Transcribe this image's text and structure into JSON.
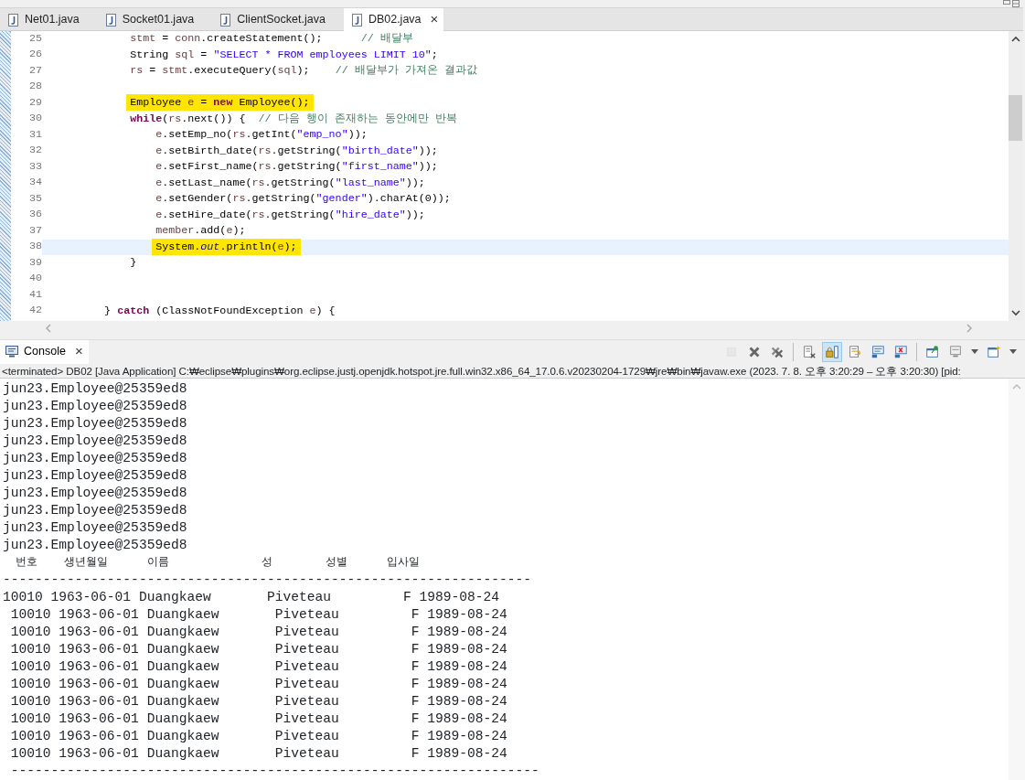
{
  "editor_tabs": [
    {
      "label": "Net01.java",
      "selected": false,
      "closable": false
    },
    {
      "label": "Socket01.java",
      "selected": false,
      "closable": false
    },
    {
      "label": "ClientSocket.java",
      "selected": false,
      "closable": false
    },
    {
      "label": "DB02.java",
      "selected": true,
      "closable": true,
      "close": "×"
    }
  ],
  "editor": {
    "lines": [
      {
        "number": "25",
        "marked": false,
        "current": false,
        "tokens": [
          {
            "text": "            stmt",
            "kind": "var"
          },
          {
            "text": " = ",
            "kind": "plain"
          },
          {
            "text": "conn",
            "kind": "var"
          },
          {
            "text": ".createStatement();      ",
            "kind": "plain"
          },
          {
            "text": "// 배달부",
            "kind": "comment"
          }
        ]
      },
      {
        "number": "26",
        "marked": false,
        "current": false,
        "tokens": [
          {
            "text": "            String ",
            "kind": "plain"
          },
          {
            "text": "sql",
            "kind": "var"
          },
          {
            "text": " = ",
            "kind": "plain"
          },
          {
            "text": "\"SELECT * FROM employees LIMIT 10\"",
            "kind": "string"
          },
          {
            "text": ";",
            "kind": "plain"
          }
        ]
      },
      {
        "number": "27",
        "marked": false,
        "current": false,
        "tokens": [
          {
            "text": "            rs",
            "kind": "var"
          },
          {
            "text": " = ",
            "kind": "plain"
          },
          {
            "text": "stmt",
            "kind": "var"
          },
          {
            "text": ".executeQuery(",
            "kind": "plain"
          },
          {
            "text": "sql",
            "kind": "var"
          },
          {
            "text": ");    ",
            "kind": "plain"
          },
          {
            "text": "// 배달부가 가져온 결과값",
            "kind": "comment"
          }
        ]
      },
      {
        "number": "28"
      },
      {
        "number": "29",
        "marked": true,
        "current": false,
        "tokens": [
          {
            "text": "            Employee ",
            "kind": "plain"
          },
          {
            "text": "e",
            "kind": "var"
          },
          {
            "text": " = ",
            "kind": "plain"
          },
          {
            "text": "new",
            "kind": "keyword"
          },
          {
            "text": " Employee();",
            "kind": "plain"
          }
        ]
      },
      {
        "number": "30",
        "marked": false,
        "current": false,
        "tokens": [
          {
            "text": "            while",
            "kind": "keyword"
          },
          {
            "text": "(",
            "kind": "plain"
          },
          {
            "text": "rs",
            "kind": "var"
          },
          {
            "text": ".next()) {  ",
            "kind": "plain"
          },
          {
            "text": "// 다음 행이 존재하는 동안에만 반복",
            "kind": "comment"
          }
        ]
      },
      {
        "number": "31",
        "marked": false,
        "current": false,
        "tokens": [
          {
            "text": "                e",
            "kind": "var"
          },
          {
            "text": ".setEmp_no(",
            "kind": "plain"
          },
          {
            "text": "rs",
            "kind": "var"
          },
          {
            "text": ".getInt(",
            "kind": "plain"
          },
          {
            "text": "\"emp_no\"",
            "kind": "string"
          },
          {
            "text": "));",
            "kind": "plain"
          }
        ]
      },
      {
        "number": "32",
        "marked": false,
        "current": false,
        "tokens": [
          {
            "text": "                e",
            "kind": "var"
          },
          {
            "text": ".setBirth_date(",
            "kind": "plain"
          },
          {
            "text": "rs",
            "kind": "var"
          },
          {
            "text": ".getString(",
            "kind": "plain"
          },
          {
            "text": "\"birth_date\"",
            "kind": "string"
          },
          {
            "text": "));",
            "kind": "plain"
          }
        ]
      },
      {
        "number": "33",
        "marked": false,
        "current": false,
        "tokens": [
          {
            "text": "                e",
            "kind": "var"
          },
          {
            "text": ".setFirst_name(",
            "kind": "plain"
          },
          {
            "text": "rs",
            "kind": "var"
          },
          {
            "text": ".getString(",
            "kind": "plain"
          },
          {
            "text": "\"first_name\"",
            "kind": "string"
          },
          {
            "text": "));",
            "kind": "plain"
          }
        ]
      },
      {
        "number": "34",
        "marked": false,
        "current": false,
        "tokens": [
          {
            "text": "                e",
            "kind": "var"
          },
          {
            "text": ".setLast_name(",
            "kind": "plain"
          },
          {
            "text": "rs",
            "kind": "var"
          },
          {
            "text": ".getString(",
            "kind": "plain"
          },
          {
            "text": "\"last_name\"",
            "kind": "string"
          },
          {
            "text": "));",
            "kind": "plain"
          }
        ]
      },
      {
        "number": "35",
        "marked": false,
        "current": false,
        "tokens": [
          {
            "text": "                e",
            "kind": "var"
          },
          {
            "text": ".setGender(",
            "kind": "plain"
          },
          {
            "text": "rs",
            "kind": "var"
          },
          {
            "text": ".getString(",
            "kind": "plain"
          },
          {
            "text": "\"gender\"",
            "kind": "string"
          },
          {
            "text": ").charAt(0));",
            "kind": "plain"
          }
        ]
      },
      {
        "number": "36",
        "marked": false,
        "current": false,
        "tokens": [
          {
            "text": "                e",
            "kind": "var"
          },
          {
            "text": ".setHire_date(",
            "kind": "plain"
          },
          {
            "text": "rs",
            "kind": "var"
          },
          {
            "text": ".getString(",
            "kind": "plain"
          },
          {
            "text": "\"hire_date\"",
            "kind": "string"
          },
          {
            "text": "));",
            "kind": "plain"
          }
        ]
      },
      {
        "number": "37",
        "marked": false,
        "current": false,
        "tokens": [
          {
            "text": "                member",
            "kind": "var"
          },
          {
            "text": ".add(",
            "kind": "plain"
          },
          {
            "text": "e",
            "kind": "var"
          },
          {
            "text": ");",
            "kind": "plain"
          }
        ]
      },
      {
        "number": "38",
        "marked": true,
        "current": true,
        "tokens": [
          {
            "text": "                System.",
            "kind": "plain"
          },
          {
            "text": "out",
            "kind": "static"
          },
          {
            "text": ".println(",
            "kind": "plain"
          },
          {
            "text": "e",
            "kind": "var"
          },
          {
            "text": ");",
            "kind": "plain"
          }
        ]
      },
      {
        "number": "39",
        "marked": false,
        "current": false,
        "tokens": [
          {
            "text": "            }",
            "kind": "plain"
          }
        ]
      },
      {
        "number": "40"
      },
      {
        "number": "41"
      },
      {
        "number": "42",
        "marked": false,
        "current": false,
        "tokens": [
          {
            "text": "        } ",
            "kind": "plain"
          },
          {
            "text": "catch",
            "kind": "keyword"
          },
          {
            "text": " (ClassNotFoundException ",
            "kind": "plain"
          },
          {
            "text": "e",
            "kind": "var"
          },
          {
            "text": ") {",
            "kind": "plain"
          }
        ]
      }
    ]
  },
  "console": {
    "tab": {
      "label": "Console",
      "close": "×"
    },
    "toolbar": [
      {
        "kind": "terminate",
        "pressed": false,
        "disabled": true
      },
      {
        "kind": "remove",
        "pressed": false,
        "disabled": false
      },
      {
        "kind": "remove-all",
        "pressed": false,
        "disabled": false
      },
      {
        "kind": "separator"
      },
      {
        "kind": "clear",
        "pressed": false,
        "disabled": false
      },
      {
        "kind": "scroll-lock",
        "pressed": true,
        "disabled": false
      },
      {
        "kind": "word-wrap",
        "pressed": false,
        "disabled": false
      },
      {
        "kind": "show-out",
        "pressed": false,
        "disabled": false
      },
      {
        "kind": "show-err",
        "pressed": false,
        "disabled": false
      },
      {
        "kind": "separator"
      },
      {
        "kind": "pin",
        "pressed": false,
        "disabled": false
      },
      {
        "kind": "display",
        "pressed": false,
        "disabled": false
      },
      {
        "kind": "dropdown",
        "pressed": false,
        "disabled": false
      },
      {
        "kind": "new-console",
        "pressed": false,
        "disabled": false
      },
      {
        "kind": "dropdown",
        "pressed": false,
        "disabled": false
      }
    ],
    "status": "<terminated> DB02 [Java Application] C:₩eclipse₩plugins₩org.eclipse.justj.openjdk.hotspot.jre.full.win32.x86_64_17.0.6.v20230204-1729₩jre₩bin₩javaw.exe  (2023. 7. 8. 오후 3:20:29 – 오후 3:20:30) [pid:",
    "output": [
      "jun23.Employee@25359ed8",
      "jun23.Employee@25359ed8",
      "jun23.Employee@25359ed8",
      "jun23.Employee@25359ed8",
      "jun23.Employee@25359ed8",
      "jun23.Employee@25359ed8",
      "jun23.Employee@25359ed8",
      "jun23.Employee@25359ed8",
      "jun23.Employee@25359ed8",
      "jun23.Employee@25359ed8",
      "  번호    생년월일      이름              성        성별      입사일",
      "------------------------------------------------------------------",
      "10010 1963-06-01 Duangkaew       Piveteau         F 1989-08-24",
      " 10010 1963-06-01 Duangkaew       Piveteau         F 1989-08-24",
      " 10010 1963-06-01 Duangkaew       Piveteau         F 1989-08-24",
      " 10010 1963-06-01 Duangkaew       Piveteau         F 1989-08-24",
      " 10010 1963-06-01 Duangkaew       Piveteau         F 1989-08-24",
      " 10010 1963-06-01 Duangkaew       Piveteau         F 1989-08-24",
      " 10010 1963-06-01 Duangkaew       Piveteau         F 1989-08-24",
      " 10010 1963-06-01 Duangkaew       Piveteau         F 1989-08-24",
      " 10010 1963-06-01 Duangkaew       Piveteau         F 1989-08-24",
      " 10010 1963-06-01 Duangkaew       Piveteau         F 1989-08-24",
      " ------------------------------------------------------------------"
    ]
  }
}
